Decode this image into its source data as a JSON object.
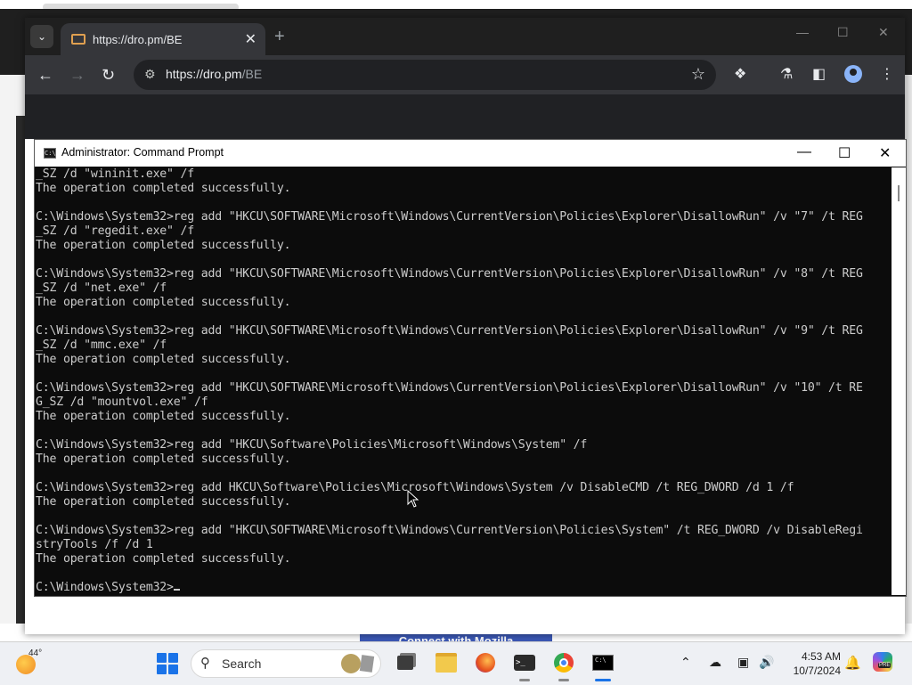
{
  "browser": {
    "tab_title": "https://dro.pm/BE",
    "new_tab": "+",
    "url_host": "https://dro.pm",
    "url_path": "/BE"
  },
  "background": {
    "banner_text": "Connect with Mozilla"
  },
  "cmd": {
    "title": "Administrator: Command Prompt",
    "lines": [
      "_SZ /d \"wininit.exe\" /f",
      "The operation completed successfully.",
      "",
      "C:\\Windows\\System32>reg add \"HKCU\\SOFTWARE\\Microsoft\\Windows\\CurrentVersion\\Policies\\Explorer\\DisallowRun\" /v \"7\" /t REG",
      "_SZ /d \"regedit.exe\" /f",
      "The operation completed successfully.",
      "",
      "C:\\Windows\\System32>reg add \"HKCU\\SOFTWARE\\Microsoft\\Windows\\CurrentVersion\\Policies\\Explorer\\DisallowRun\" /v \"8\" /t REG",
      "_SZ /d \"net.exe\" /f",
      "The operation completed successfully.",
      "",
      "C:\\Windows\\System32>reg add \"HKCU\\SOFTWARE\\Microsoft\\Windows\\CurrentVersion\\Policies\\Explorer\\DisallowRun\" /v \"9\" /t REG",
      "_SZ /d \"mmc.exe\" /f",
      "The operation completed successfully.",
      "",
      "C:\\Windows\\System32>reg add \"HKCU\\SOFTWARE\\Microsoft\\Windows\\CurrentVersion\\Policies\\Explorer\\DisallowRun\" /v \"10\" /t RE",
      "G_SZ /d \"mountvol.exe\" /f",
      "The operation completed successfully.",
      "",
      "C:\\Windows\\System32>reg add \"HKCU\\Software\\Policies\\Microsoft\\Windows\\System\" /f",
      "The operation completed successfully.",
      "",
      "C:\\Windows\\System32>reg add HKCU\\Software\\Policies\\Microsoft\\Windows\\System /v DisableCMD /t REG_DWORD /d 1 /f",
      "The operation completed successfully.",
      "",
      "C:\\Windows\\System32>reg add \"HKCU\\SOFTWARE\\Microsoft\\Windows\\CurrentVersion\\Policies\\System\" /t REG_DWORD /v DisableRegi",
      "stryTools /f /d 1",
      "The operation completed successfully.",
      ""
    ],
    "prompt": "C:\\Windows\\System32>"
  },
  "taskbar": {
    "weather_temp": "44°",
    "search_placeholder": "Search",
    "time": "4:53 AM",
    "date": "10/7/2024",
    "copilot_badge": "PRE"
  }
}
